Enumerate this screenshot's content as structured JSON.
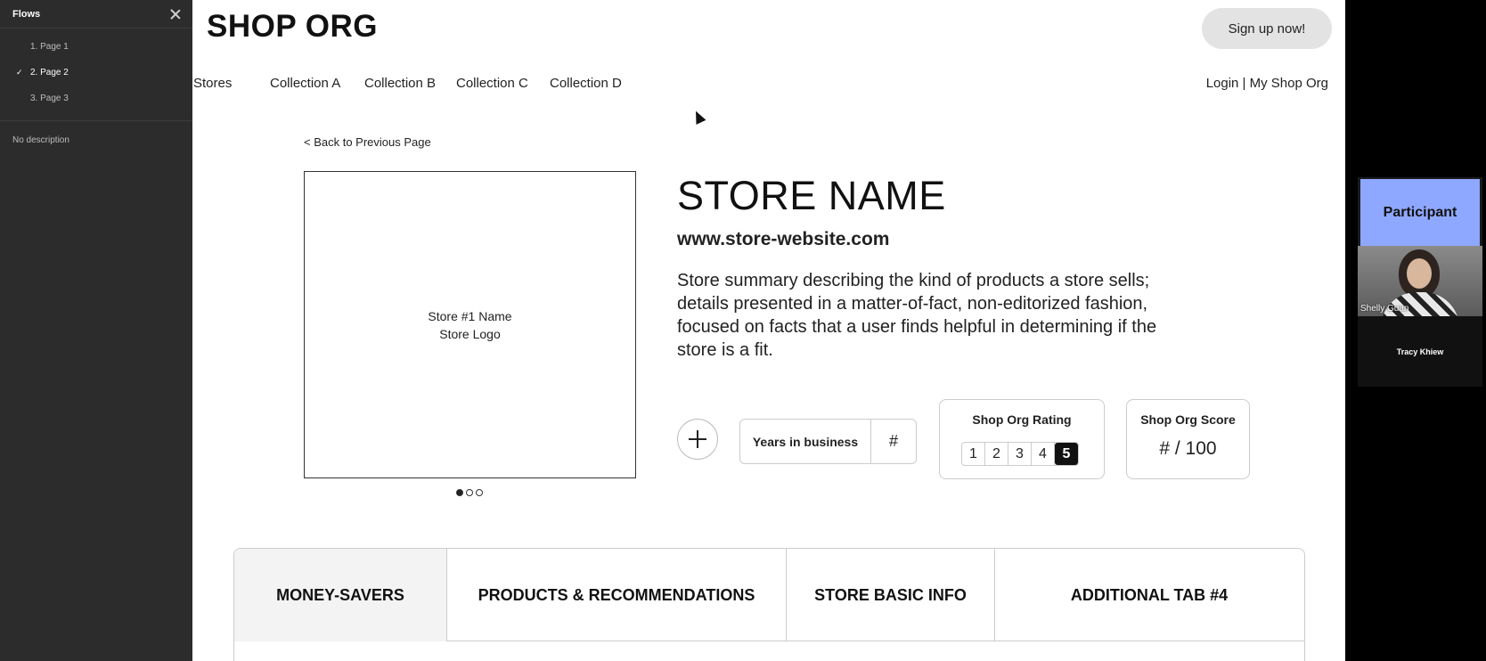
{
  "flows_panel": {
    "title": "Flows",
    "items": [
      {
        "label": "1. Page 1",
        "active": false
      },
      {
        "label": "2. Page 2",
        "active": true
      },
      {
        "label": "3. Page 3",
        "active": false
      }
    ],
    "description": "No description",
    "check_glyph": "✓"
  },
  "header": {
    "logo": "SHOP ORG",
    "signup_label": "Sign up now!",
    "nav": [
      "Stores",
      "Collection A",
      "Collection B",
      "Collection C",
      "Collection D"
    ],
    "account_links": "Login | My Shop Org"
  },
  "store": {
    "back_link": "< Back to Previous Page",
    "logo_line1": "Store #1 Name",
    "logo_line2": "Store Logo",
    "name": "STORE NAME",
    "website": "www.store-website.com",
    "summary": "Store summary describing the kind of products a store sells; details presented in a matter-of-fact, non-editorized fashion, focused on facts that a user finds helpful in determining if the store is a fit.",
    "carousel": {
      "count": 3,
      "active": 0
    }
  },
  "stats": {
    "years_label": "Years in business",
    "years_value": "#",
    "rating_title": "Shop Org Rating",
    "rating_scale": [
      "1",
      "2",
      "3",
      "4",
      "5"
    ],
    "rating_selected": "5",
    "score_title": "Shop Org Score",
    "score_value": "# / 100"
  },
  "tabs": [
    {
      "label": "MONEY-SAVERS",
      "active": true
    },
    {
      "label": "PRODUCTS & RECOMMENDATIONS",
      "active": false
    },
    {
      "label": "STORE BASIC INFO",
      "active": false
    },
    {
      "label": "ADDITIONAL TAB #4",
      "active": false
    }
  ],
  "video_call": {
    "participant_label": "Participant",
    "camera_name": "Shelly Guan",
    "other_name": "Tracy Khiew"
  },
  "colors": {
    "participant_tile": "#8fa8ff",
    "panel_bg": "#2c2c2c",
    "rating_selected_bg": "#111111"
  }
}
